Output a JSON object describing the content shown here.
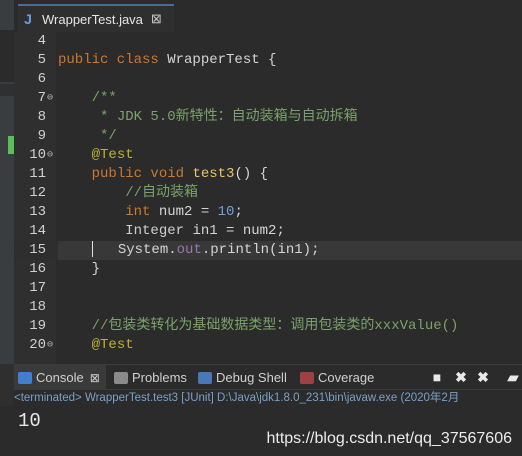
{
  "editor_tab": {
    "title": "WrapperTest.java",
    "close": "⊠"
  },
  "code_lines": [
    {
      "ln": "4",
      "fold": "",
      "html": ""
    },
    {
      "ln": "5",
      "fold": "",
      "html": "<span class='kw'>public class </span><span class='id'>WrapperTest {</span>"
    },
    {
      "ln": "6",
      "fold": "",
      "html": ""
    },
    {
      "ln": "7",
      "fold": "⊖",
      "html": "    <span class='cm'>/**</span>"
    },
    {
      "ln": "8",
      "fold": "",
      "html": "     <span class='cm'>* JDK 5.0新特性：自动装箱与自动拆箱</span>"
    },
    {
      "ln": "9",
      "fold": "",
      "html": "     <span class='cm'>*/</span>"
    },
    {
      "ln": "10",
      "fold": "⊖",
      "html": "    <span class='an'>@Test</span>"
    },
    {
      "ln": "11",
      "fold": "",
      "html": "    <span class='kw'>public void </span><span class='fn'>test3</span><span class='id'>() {</span>"
    },
    {
      "ln": "12",
      "fold": "",
      "html": "        <span class='cm'>//自动装箱</span>"
    },
    {
      "ln": "13",
      "fold": "",
      "html": "        <span class='kw'>int </span><span class='id'>num2 = </span><span class='num'>10</span><span class='id'>;</span>"
    },
    {
      "ln": "14",
      "fold": "",
      "html": "        <span class='ty'>Integer </span><span class='id'>in1 = num2;</span>"
    },
    {
      "ln": "15",
      "fold": "",
      "html": "    <span class='caret'></span>   <span class='id'>System.</span><span class='fld'>out</span><span class='id'>.println(in1);</span>"
    },
    {
      "ln": "16",
      "fold": "",
      "html": "    <span class='id'>}</span>"
    },
    {
      "ln": "17",
      "fold": "",
      "html": ""
    },
    {
      "ln": "18",
      "fold": "",
      "html": ""
    },
    {
      "ln": "19",
      "fold": "",
      "html": "    <span class='cm'>//包装类转化为基础数据类型：调用包装类的xxxValue()</span>"
    },
    {
      "ln": "20",
      "fold": "⊖",
      "html": "    <span class='an'>@Test</span>"
    }
  ],
  "current_line_index": 11,
  "console_tabs": [
    {
      "label": "Console",
      "icon": "console-icon",
      "color": "#3f7fd0",
      "active": true,
      "close": "⊠"
    },
    {
      "label": "Problems",
      "icon": "problems-icon",
      "color": "#8a8a8a",
      "active": false
    },
    {
      "label": "Debug Shell",
      "icon": "debug-shell-icon",
      "color": "#4a77b8",
      "active": false
    },
    {
      "label": "Coverage",
      "icon": "coverage-icon",
      "color": "#a04040",
      "active": false
    }
  ],
  "toolbar": {
    "terminate": "■",
    "remove": "✖",
    "remove_all": "✖",
    "clear": "▰"
  },
  "console_status": "<terminated> WrapperTest.test3 [JUnit] D:\\Java\\jdk1.8.0_231\\bin\\javaw.exe (2020年2月",
  "console_output": "10",
  "watermark": "https://blog.csdn.net/qq_37567606"
}
